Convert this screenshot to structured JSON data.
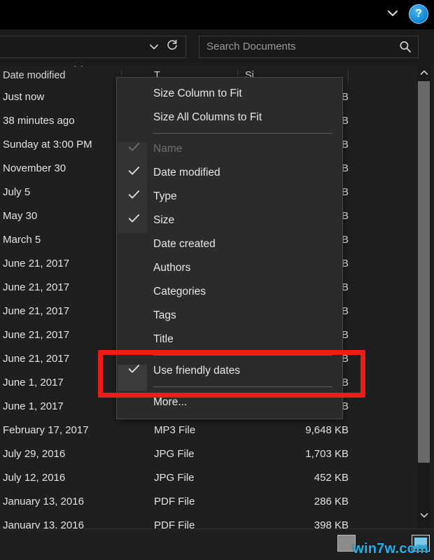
{
  "window": {
    "collapse_ribbon_icon": "chevron-down-icon",
    "help_label": "?",
    "help_icon": "help-icon"
  },
  "navbar": {
    "address_value": "",
    "address_dropdown_icon": "chevron-down-icon",
    "refresh_icon": "refresh-icon",
    "search_placeholder": "Search Documents",
    "search_value": "",
    "search_icon": "search-icon"
  },
  "columns": [
    {
      "label": "Date modified",
      "sorted": true,
      "sort_icon": "caret-up-icon"
    },
    {
      "label": "T",
      "sorted": false,
      "sort_icon": ""
    },
    {
      "label": "Si",
      "sorted": false,
      "sort_icon": ""
    }
  ],
  "files": [
    {
      "date": "Just now",
      "type": "",
      "size": "KB"
    },
    {
      "date": "38 minutes ago",
      "type": "",
      "size": "KB"
    },
    {
      "date": "Sunday at 3:00 PM",
      "type": "",
      "size": "KB"
    },
    {
      "date": "November 30",
      "type": "",
      "size": "KB"
    },
    {
      "date": "July 5",
      "type": "",
      "size": "KB"
    },
    {
      "date": "May 30",
      "type": "",
      "size": "KB"
    },
    {
      "date": "March 5",
      "type": "",
      "size": "KB"
    },
    {
      "date": "June 21, 2017",
      "type": "",
      "size": "KB"
    },
    {
      "date": "June 21, 2017",
      "type": "",
      "size": "KB"
    },
    {
      "date": "June 21, 2017",
      "type": "",
      "size": "KB"
    },
    {
      "date": "June 21, 2017",
      "type": "",
      "size": "KB"
    },
    {
      "date": "June 21, 2017",
      "type": "",
      "size": "KB"
    },
    {
      "date": "June 1, 2017",
      "type": "",
      "size": "KB"
    },
    {
      "date": "June 1, 2017",
      "type": "",
      "size": "KB"
    },
    {
      "date": "February 17, 2017",
      "type": "MP3 File",
      "size": "9,648 KB"
    },
    {
      "date": "July 29, 2016",
      "type": "JPG File",
      "size": "1,703 KB"
    },
    {
      "date": "July 12, 2016",
      "type": "JPG File",
      "size": "452 KB"
    },
    {
      "date": "January 13, 2016",
      "type": "PDF File",
      "size": "286 KB"
    },
    {
      "date": "January 13, 2016",
      "type": "PDF File",
      "size": "398 KB"
    }
  ],
  "scrollbar": {
    "up_icon": "caret-up-icon",
    "down_icon": "caret-down-icon"
  },
  "context_menu": {
    "items": [
      {
        "label": "Size Column to Fit",
        "checked": false,
        "disabled": false,
        "separator_after": false
      },
      {
        "label": "Size All Columns to Fit",
        "checked": false,
        "disabled": false,
        "separator_after": true
      },
      {
        "label": "Name",
        "checked": true,
        "disabled": true,
        "separator_after": false
      },
      {
        "label": "Date modified",
        "checked": true,
        "disabled": false,
        "separator_after": false
      },
      {
        "label": "Type",
        "checked": true,
        "disabled": false,
        "separator_after": false
      },
      {
        "label": "Size",
        "checked": true,
        "disabled": false,
        "separator_after": false
      },
      {
        "label": "Date created",
        "checked": false,
        "disabled": false,
        "separator_after": false
      },
      {
        "label": "Authors",
        "checked": false,
        "disabled": false,
        "separator_after": false
      },
      {
        "label": "Categories",
        "checked": false,
        "disabled": false,
        "separator_after": false
      },
      {
        "label": "Tags",
        "checked": false,
        "disabled": false,
        "separator_after": false
      },
      {
        "label": "Title",
        "checked": false,
        "disabled": false,
        "separator_after": true
      },
      {
        "label": "Use friendly dates",
        "checked": true,
        "disabled": false,
        "separator_after": true
      },
      {
        "label": "More...",
        "checked": false,
        "disabled": false,
        "separator_after": false
      }
    ],
    "check_icon": "checkmark-icon"
  },
  "annotation": {
    "color": "#ee1c18",
    "target_label": "Use friendly dates"
  },
  "watermark": {
    "text": "win7w.com",
    "color": "#14b7f0"
  }
}
